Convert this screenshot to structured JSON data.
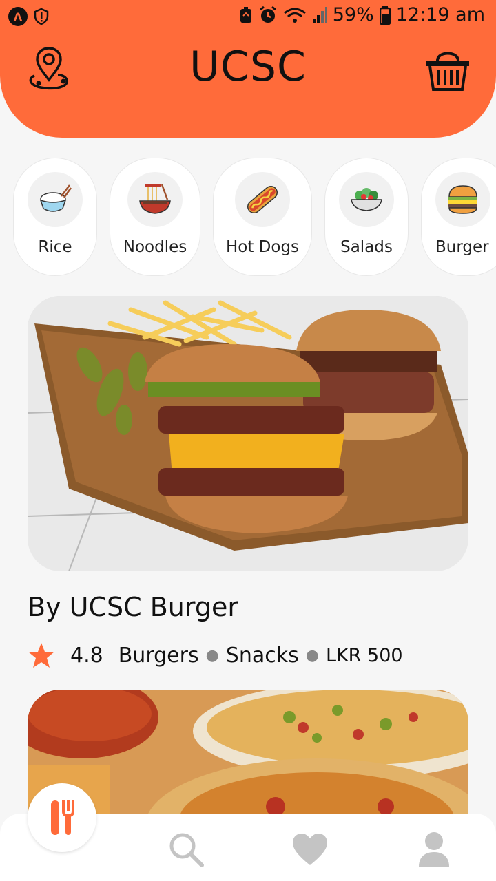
{
  "status_bar": {
    "left_icons": [
      "app-icon",
      "shield-alert-icon"
    ],
    "app_glyph": "Λ",
    "battery_percent": "59%",
    "time": "12:19 am",
    "right_icons": [
      "sync-icon",
      "alarm-icon",
      "wifi-icon",
      "signal-icon",
      "battery-icon"
    ]
  },
  "header": {
    "title": "UCSC",
    "left_icon": "location-pin-icon",
    "right_icon": "basket-icon",
    "color": "#ff6b3a"
  },
  "categories": [
    {
      "label": "Rice",
      "icon": "rice-bowl-icon"
    },
    {
      "label": "Noodles",
      "icon": "noodles-icon"
    },
    {
      "label": "Hot Dogs",
      "icon": "hot-dog-icon"
    },
    {
      "label": "Salads",
      "icon": "salad-icon"
    },
    {
      "label": "Burger",
      "icon": "burger-icon"
    }
  ],
  "restaurants": [
    {
      "name": "By UCSC Burger",
      "rating": "4.8",
      "tags": [
        "Burgers",
        "Snacks"
      ],
      "price": "LKR 500",
      "image": "burger-photo"
    },
    {
      "image": "pizza-photo"
    }
  ],
  "bottom_nav": {
    "items": [
      "restaurant-icon",
      "search-icon",
      "heart-icon",
      "profile-icon"
    ],
    "active": "restaurant-icon"
  },
  "colors": {
    "accent": "#ff6b3a",
    "inactive_icon": "#c4c4c4"
  }
}
